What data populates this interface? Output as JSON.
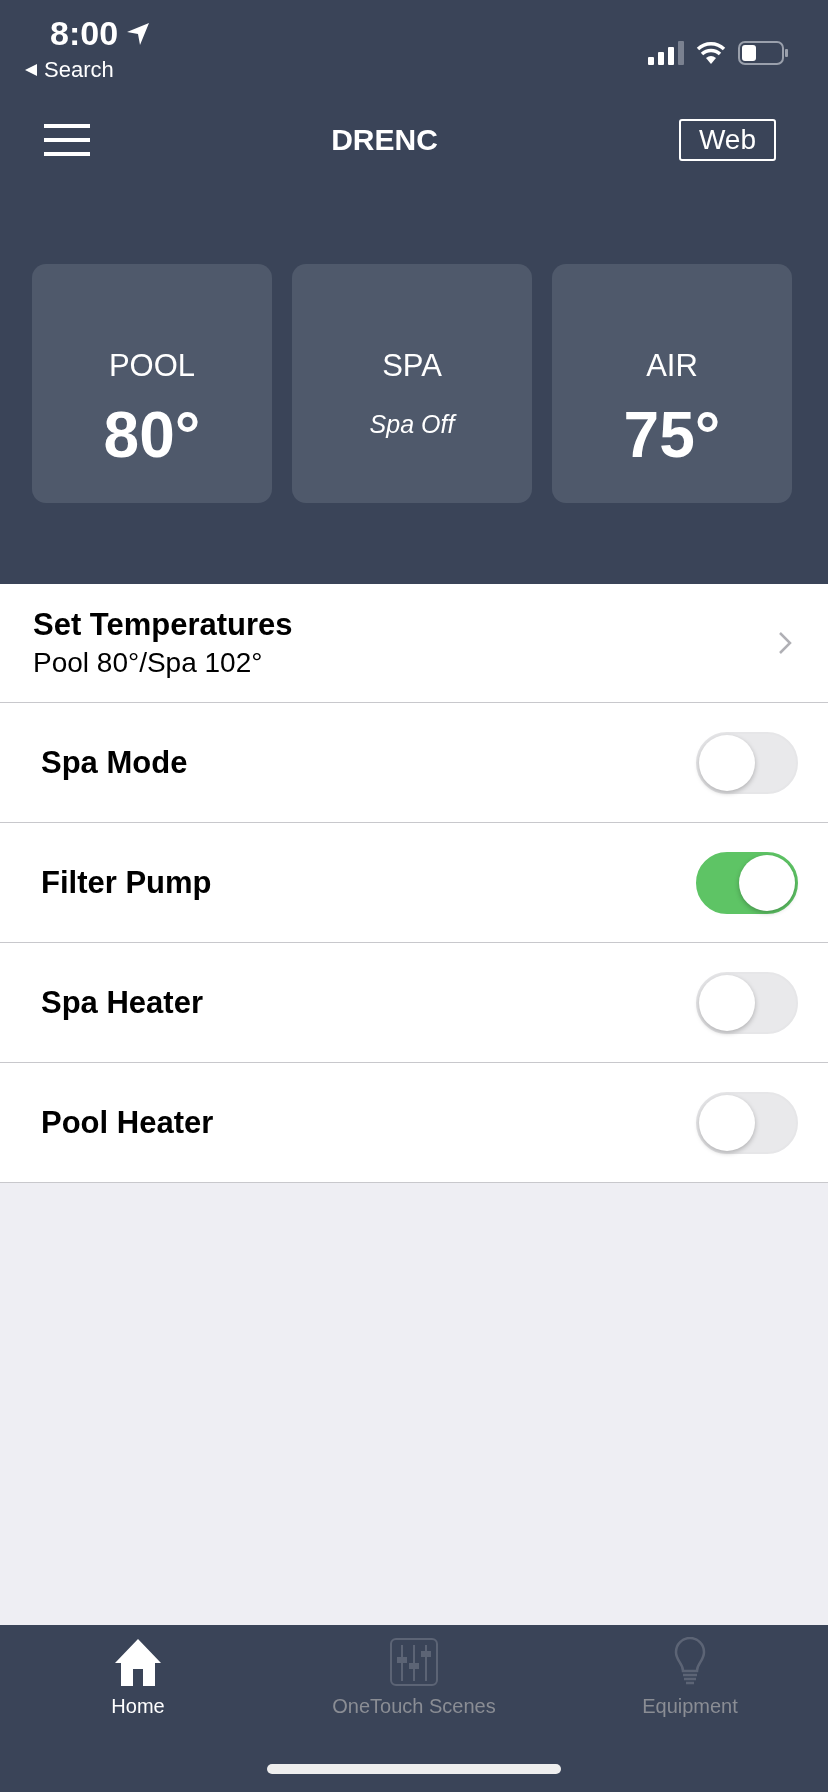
{
  "status_bar": {
    "time": "8:00",
    "back_link": "Search"
  },
  "nav": {
    "title": "DRENC",
    "button": "Web"
  },
  "cards": [
    {
      "label": "POOL",
      "value": "80°",
      "kind": "temperature"
    },
    {
      "label": "SPA",
      "value": "Spa Off",
      "kind": "status"
    },
    {
      "label": "AIR",
      "value": "75°",
      "kind": "temperature"
    }
  ],
  "set_temperatures": {
    "title": "Set Temperatures",
    "subtitle": "Pool 80°/Spa 102°"
  },
  "toggles": [
    {
      "label": "Spa Mode",
      "on": false
    },
    {
      "label": "Filter Pump",
      "on": true
    },
    {
      "label": "Spa Heater",
      "on": false
    },
    {
      "label": "Pool Heater",
      "on": false
    }
  ],
  "tabs": [
    {
      "label": "Home",
      "selected": true,
      "kind": "home"
    },
    {
      "label": "OneTouch Scenes",
      "selected": false,
      "kind": "scenes"
    },
    {
      "label": "Equipment",
      "selected": false,
      "kind": "equipment"
    }
  ]
}
